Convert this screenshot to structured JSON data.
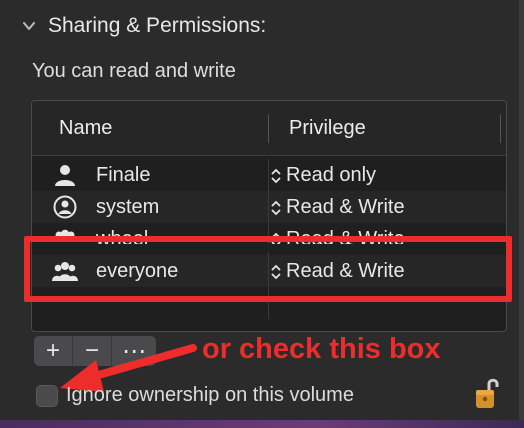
{
  "section": {
    "title": "Sharing & Permissions:"
  },
  "permission_text": "You can read and write",
  "table": {
    "headers": {
      "name": "Name",
      "privilege": "Privilege"
    },
    "rows": [
      {
        "name": "Finale",
        "privilege": "Read only",
        "icon": "user-icon"
      },
      {
        "name": "system",
        "privilege": "Read & Write",
        "icon": "user-circle-icon"
      },
      {
        "name": "wheel",
        "privilege": "Read & Write",
        "icon": "group-icon"
      },
      {
        "name": "everyone",
        "privilege": "Read & Write",
        "icon": "group-icon"
      }
    ]
  },
  "toolbar": {
    "add_label": "+",
    "remove_label": "−",
    "more_label": "⋯"
  },
  "annotation": "or check this box",
  "checkbox": {
    "label": "Ignore ownership on this volume",
    "checked": false
  },
  "colors": {
    "highlight": "#ee2c2c",
    "background": "#2b2b2c"
  }
}
